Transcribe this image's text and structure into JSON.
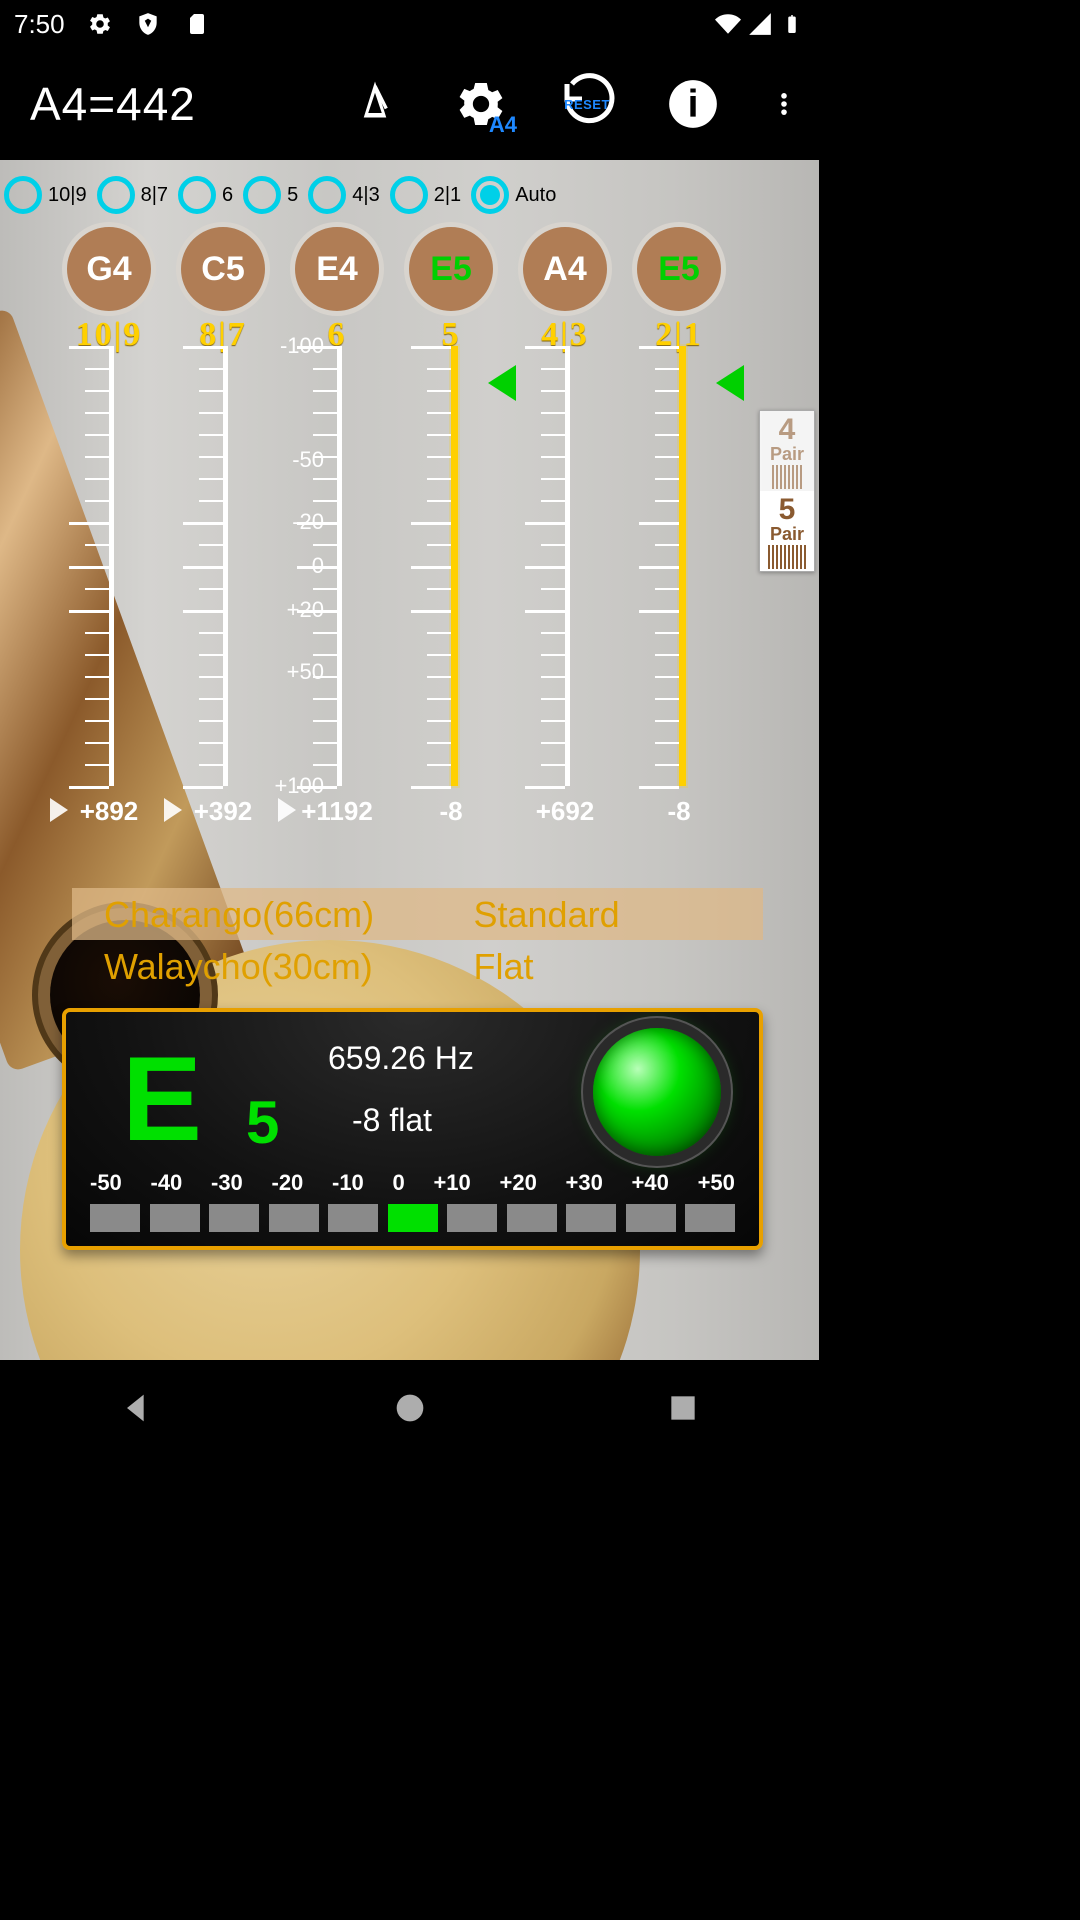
{
  "status": {
    "time": "7:50"
  },
  "actionbar": {
    "title": "A4=442"
  },
  "radios": [
    {
      "label": "10|9",
      "checked": false
    },
    {
      "label": "8|7",
      "checked": false
    },
    {
      "label": "6",
      "checked": false
    },
    {
      "label": "5",
      "checked": false
    },
    {
      "label": "4|3",
      "checked": false
    },
    {
      "label": "2|1",
      "checked": false
    },
    {
      "label": "Auto",
      "checked": true
    }
  ],
  "pegs": [
    {
      "note": "G4",
      "green": false
    },
    {
      "note": "C5",
      "green": false
    },
    {
      "note": "E4",
      "green": false
    },
    {
      "note": "E5",
      "green": true
    },
    {
      "note": "A4",
      "green": false
    },
    {
      "note": "E5",
      "green": true
    }
  ],
  "pair_labels": [
    "10|9",
    "8|7",
    "6",
    "5",
    "4|3",
    "2|1"
  ],
  "scale_labels": [
    "-100",
    "-50",
    "-20",
    "0",
    "+20",
    "+50",
    "+100"
  ],
  "cents": [
    "+892",
    "+392",
    "+1192",
    "-8",
    "+692",
    "-8"
  ],
  "pair_selector": [
    {
      "num": "4",
      "txt": "Pair",
      "selected": false
    },
    {
      "num": "5",
      "txt": "Pair",
      "selected": true
    }
  ],
  "instruments": [
    {
      "name": "Charango(66cm)",
      "tuning": "Standard",
      "selected": true
    },
    {
      "name": "Walaycho(30cm)",
      "tuning": "Flat",
      "selected": false
    }
  ],
  "tuner": {
    "note": "E",
    "octave": "5",
    "freq": "659.26 Hz",
    "deviation": "-8 flat",
    "scale": [
      "-50",
      "-40",
      "-30",
      "-20",
      "-10",
      "0",
      "+10",
      "+20",
      "+30",
      "+40",
      "+50"
    ],
    "active_box_index": 5
  }
}
